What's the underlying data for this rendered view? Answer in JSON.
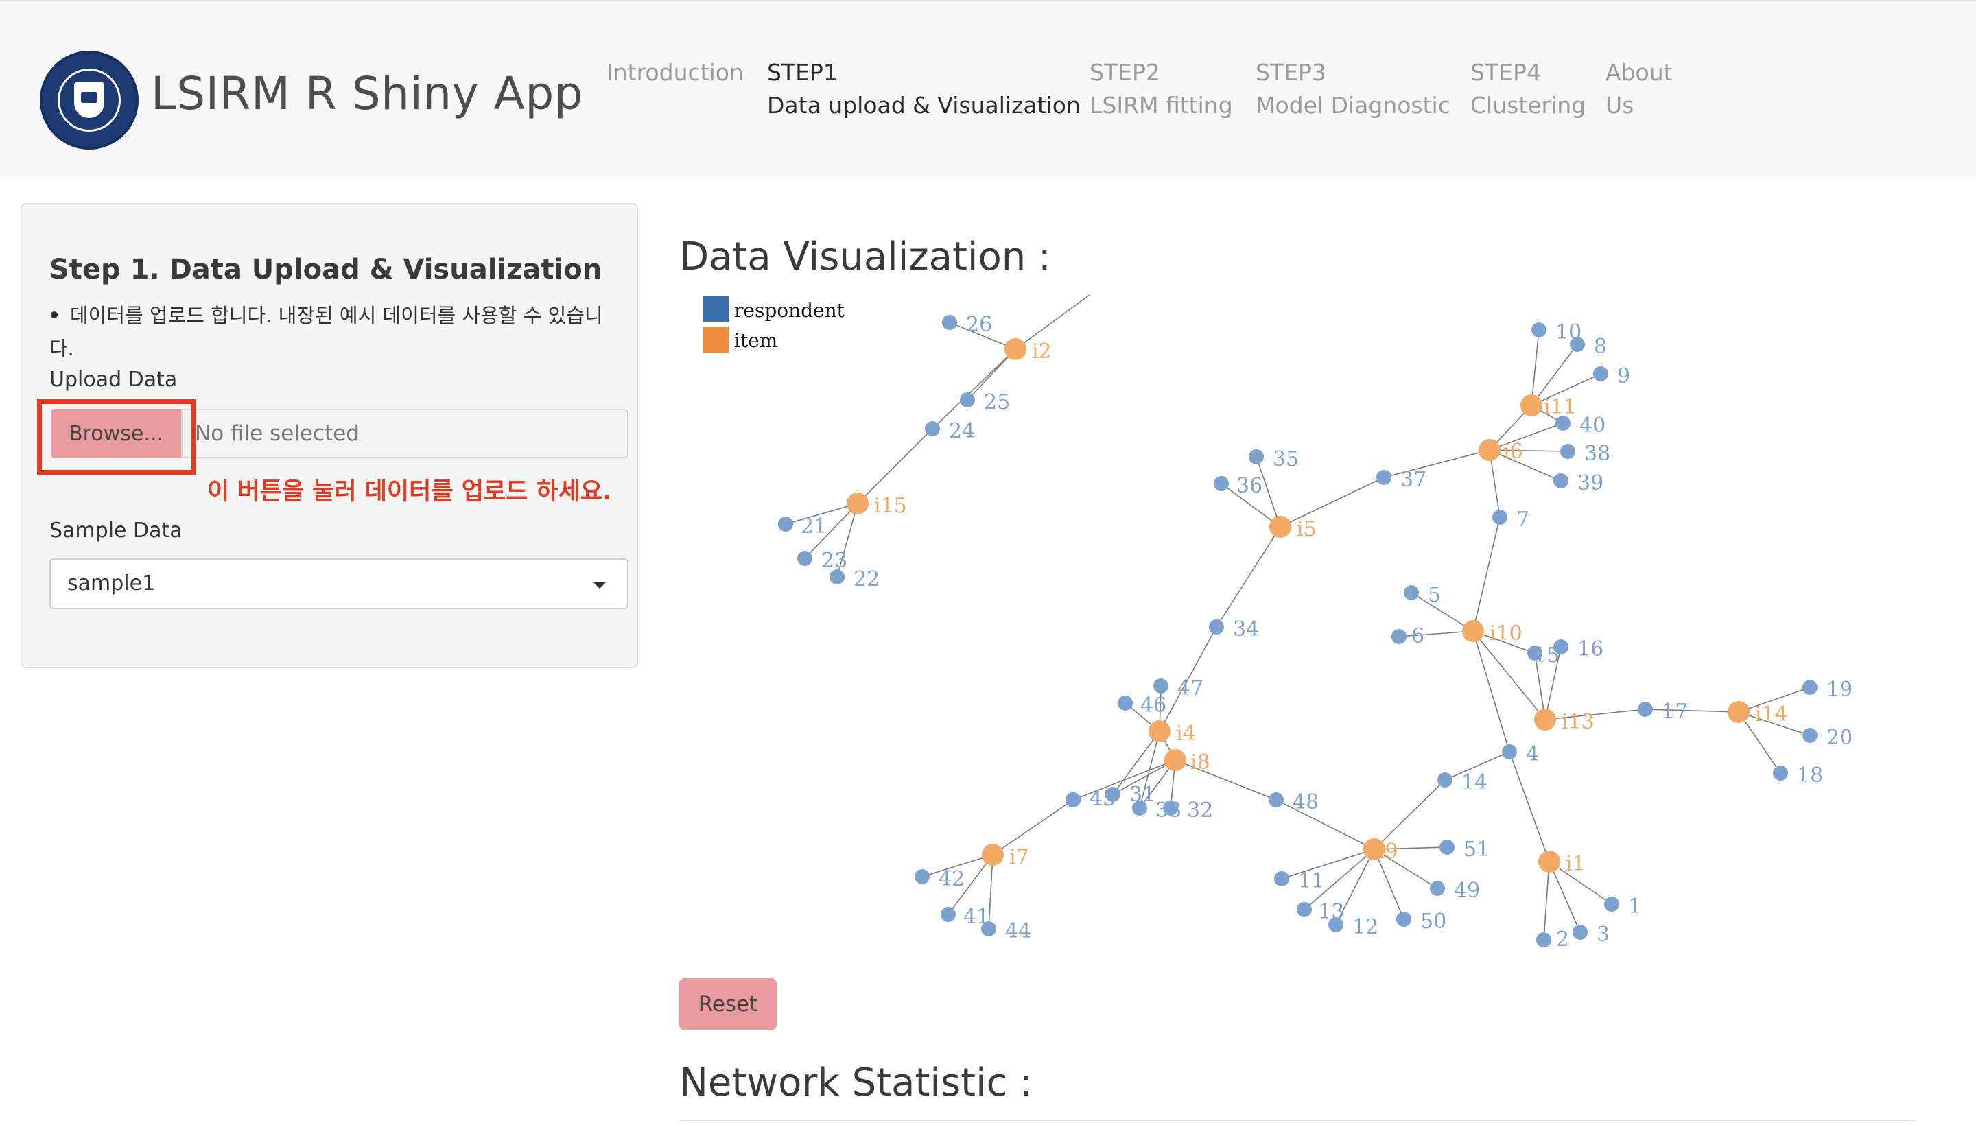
{
  "app": {
    "title": "LSIRM R Shiny App",
    "logo": "yonsei-university-seal"
  },
  "nav": [
    {
      "line1": "Introduction",
      "line2": ""
    },
    {
      "line1": "STEP1",
      "line2": "Data upload & Visualization"
    },
    {
      "line1": "STEP2",
      "line2": "LSIRM fitting"
    },
    {
      "line1": "STEP3",
      "line2": "Model Diagnostic"
    },
    {
      "line1": "STEP4",
      "line2": "Clustering"
    },
    {
      "line1": "About",
      "line2": "Us"
    }
  ],
  "sidebar": {
    "title": "Step 1. Data Upload & Visualization",
    "description": "데이터를 업로드 합니다. 내장된 예시 데이터를 사용할 수 있습니다.",
    "upload_label": "Upload Data",
    "browse_label": "Browse...",
    "file_placeholder": "No file selected",
    "annotation": "이 버튼을 눌러 데이터를 업로드 하세요.",
    "sample_label": "Sample Data",
    "sample_value": "sample1"
  },
  "main": {
    "vis_heading": "Data Visualization :",
    "reset_label": "Reset",
    "stat_heading": "Network Statistic :"
  },
  "network": {
    "legend": [
      {
        "label": "respondent",
        "color": "#3a6fae"
      },
      {
        "label": "item",
        "color": "#ee8a3b"
      }
    ],
    "node_colors": {
      "respondent": "#7da1cf",
      "item": "#f3a865",
      "edge": "#7a7a7a"
    },
    "items": [
      "i1",
      "i2",
      "i4",
      "i5",
      "i6",
      "i7",
      "i8",
      "i9",
      "i10",
      "i11",
      "i13",
      "i14",
      "i15"
    ],
    "respondents": [
      "1",
      "2",
      "3",
      "4",
      "5",
      "6",
      "7",
      "8",
      "9",
      "10",
      "11",
      "12",
      "13",
      "14",
      "15",
      "16",
      "17",
      "18",
      "19",
      "20",
      "21",
      "22",
      "23",
      "24",
      "25",
      "26",
      "31",
      "32",
      "33",
      "34",
      "35",
      "36",
      "37",
      "38",
      "39",
      "40",
      "41",
      "42",
      "43",
      "44",
      "45",
      "46",
      "47",
      "48",
      "49",
      "50",
      "51"
    ]
  }
}
